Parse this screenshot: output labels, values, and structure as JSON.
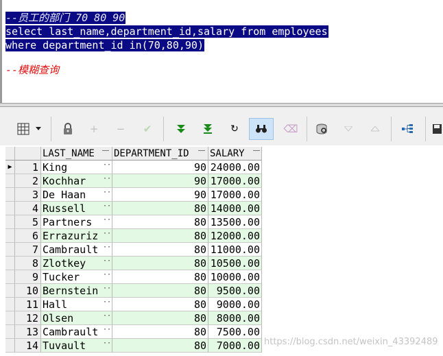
{
  "editor": {
    "line1": "--员工的部门 70 80 90",
    "line2": "select last_name,department_id,salary from employees",
    "line3": "where department_id in(70,80,90)",
    "line5": "--模糊查询"
  },
  "toolbar": {
    "icons": [
      "grid-view-icon",
      "dropdown-arrow-icon",
      "lock-icon",
      "add-record-icon",
      "delete-record-icon",
      "post-changes-icon",
      "fetch-next-icon",
      "fetch-last-icon",
      "refresh-icon",
      "find-icon",
      "clear-icon",
      "query-by-example-icon",
      "sort-down-icon",
      "sort-up-icon",
      "explain-plan-icon",
      "save-icon"
    ]
  },
  "grid": {
    "headers": {
      "last_name": "LAST_NAME",
      "department_id": "DEPARTMENT_ID",
      "salary": "SALARY"
    },
    "current_row_marker": "▶",
    "rows": [
      {
        "n": "1",
        "last_name": "King",
        "department_id": "90",
        "salary": "24000.00"
      },
      {
        "n": "2",
        "last_name": "Kochhar",
        "department_id": "90",
        "salary": "17000.00"
      },
      {
        "n": "3",
        "last_name": "De Haan",
        "department_id": "90",
        "salary": "17000.00"
      },
      {
        "n": "4",
        "last_name": "Russell",
        "department_id": "80",
        "salary": "14000.00"
      },
      {
        "n": "5",
        "last_name": "Partners",
        "department_id": "80",
        "salary": "13500.00"
      },
      {
        "n": "6",
        "last_name": "Errazuriz",
        "department_id": "80",
        "salary": "12000.00"
      },
      {
        "n": "7",
        "last_name": "Cambrault",
        "department_id": "80",
        "salary": "11000.00"
      },
      {
        "n": "8",
        "last_name": "Zlotkey",
        "department_id": "80",
        "salary": "10500.00"
      },
      {
        "n": "9",
        "last_name": "Tucker",
        "department_id": "80",
        "salary": "10000.00"
      },
      {
        "n": "10",
        "last_name": "Bernstein",
        "department_id": "80",
        "salary": "9500.00"
      },
      {
        "n": "11",
        "last_name": "Hall",
        "department_id": "80",
        "salary": "9000.00"
      },
      {
        "n": "12",
        "last_name": "Olsen",
        "department_id": "80",
        "salary": "8000.00"
      },
      {
        "n": "13",
        "last_name": "Cambrault",
        "department_id": "80",
        "salary": "7500.00"
      },
      {
        "n": "14",
        "last_name": "Tuvault",
        "department_id": "80",
        "salary": "7000.00"
      }
    ]
  },
  "watermark": "https://blog.csdn.net/weixin_43392489"
}
